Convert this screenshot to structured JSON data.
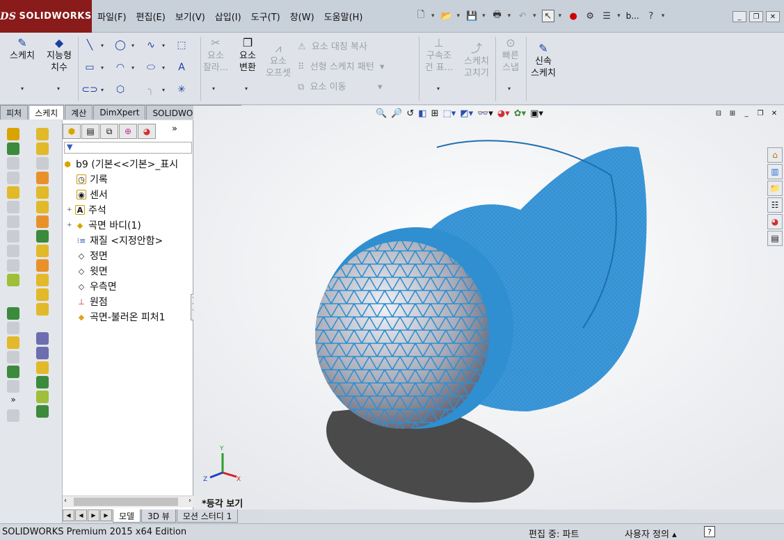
{
  "app": {
    "logo": "SOLIDWORKS",
    "logo_mark": "DS"
  },
  "menu": [
    "파일(F)",
    "편집(E)",
    "보기(V)",
    "삽입(I)",
    "도구(T)",
    "창(W)",
    "도움말(H)"
  ],
  "quick_title": "b...",
  "ribbon": {
    "sketch": "스케치",
    "smart_dim_1": "지능형",
    "smart_dim_2": "치수",
    "trim_1": "요소",
    "trim_2": "잘라...",
    "convert_1": "요소",
    "convert_2": "변환",
    "offset_1": "요소",
    "offset_2": "오프셋",
    "mirror": "요소 대칭 복사",
    "linear_pattern": "선형 스케치 패턴",
    "move": "요소 이동",
    "relations_1": "구속조",
    "relations_2": "건 표...",
    "repair_1": "스케치",
    "repair_2": "고치기",
    "quick_snap_1": "빠른",
    "quick_snap_2": "스냅",
    "rapid_1": "신속",
    "rapid_2": "스케치"
  },
  "cm_tabs": [
    "피처",
    "스케치",
    "계산",
    "DimXpert",
    "SOLIDWORKS 애드인"
  ],
  "active_cm_tab": "스케치",
  "feature_tree": [
    {
      "label": "b9  (기본<<기본>_표시",
      "icon": "part-icon",
      "expand": ""
    },
    {
      "label": "기록",
      "icon": "history-icon",
      "expand": ""
    },
    {
      "label": "센서",
      "icon": "sensor-icon",
      "expand": ""
    },
    {
      "label": "주석",
      "icon": "annotation-icon",
      "expand": "+"
    },
    {
      "label": "곡면 바디(1)",
      "icon": "surface-bodies-icon",
      "expand": "+"
    },
    {
      "label": "재질 <지정안함>",
      "icon": "material-icon",
      "expand": ""
    },
    {
      "label": "정면",
      "icon": "plane-icon",
      "expand": ""
    },
    {
      "label": "윗면",
      "icon": "plane-icon",
      "expand": ""
    },
    {
      "label": "우측면",
      "icon": "plane-icon",
      "expand": ""
    },
    {
      "label": "원점",
      "icon": "origin-icon",
      "expand": ""
    },
    {
      "label": "곡면-불러온 피처1",
      "icon": "imported-surface-icon",
      "expand": ""
    }
  ],
  "viewport": {
    "view_name": "*등각 보기",
    "axis_x": "X",
    "axis_y": "Y",
    "axis_z": "Z"
  },
  "bottom_tabs": [
    "모델",
    "3D 뷰",
    "모션 스터디 1"
  ],
  "active_bottom_tab": "모델",
  "status": {
    "product": "SOLIDWORKS Premium 2015 x64 Edition",
    "mode": "편집 중: 파트",
    "units": "사용자 정의",
    "help": "?"
  },
  "colors": {
    "mesh": "#2f8fd0",
    "logo_bg": "#8a1b1b"
  }
}
